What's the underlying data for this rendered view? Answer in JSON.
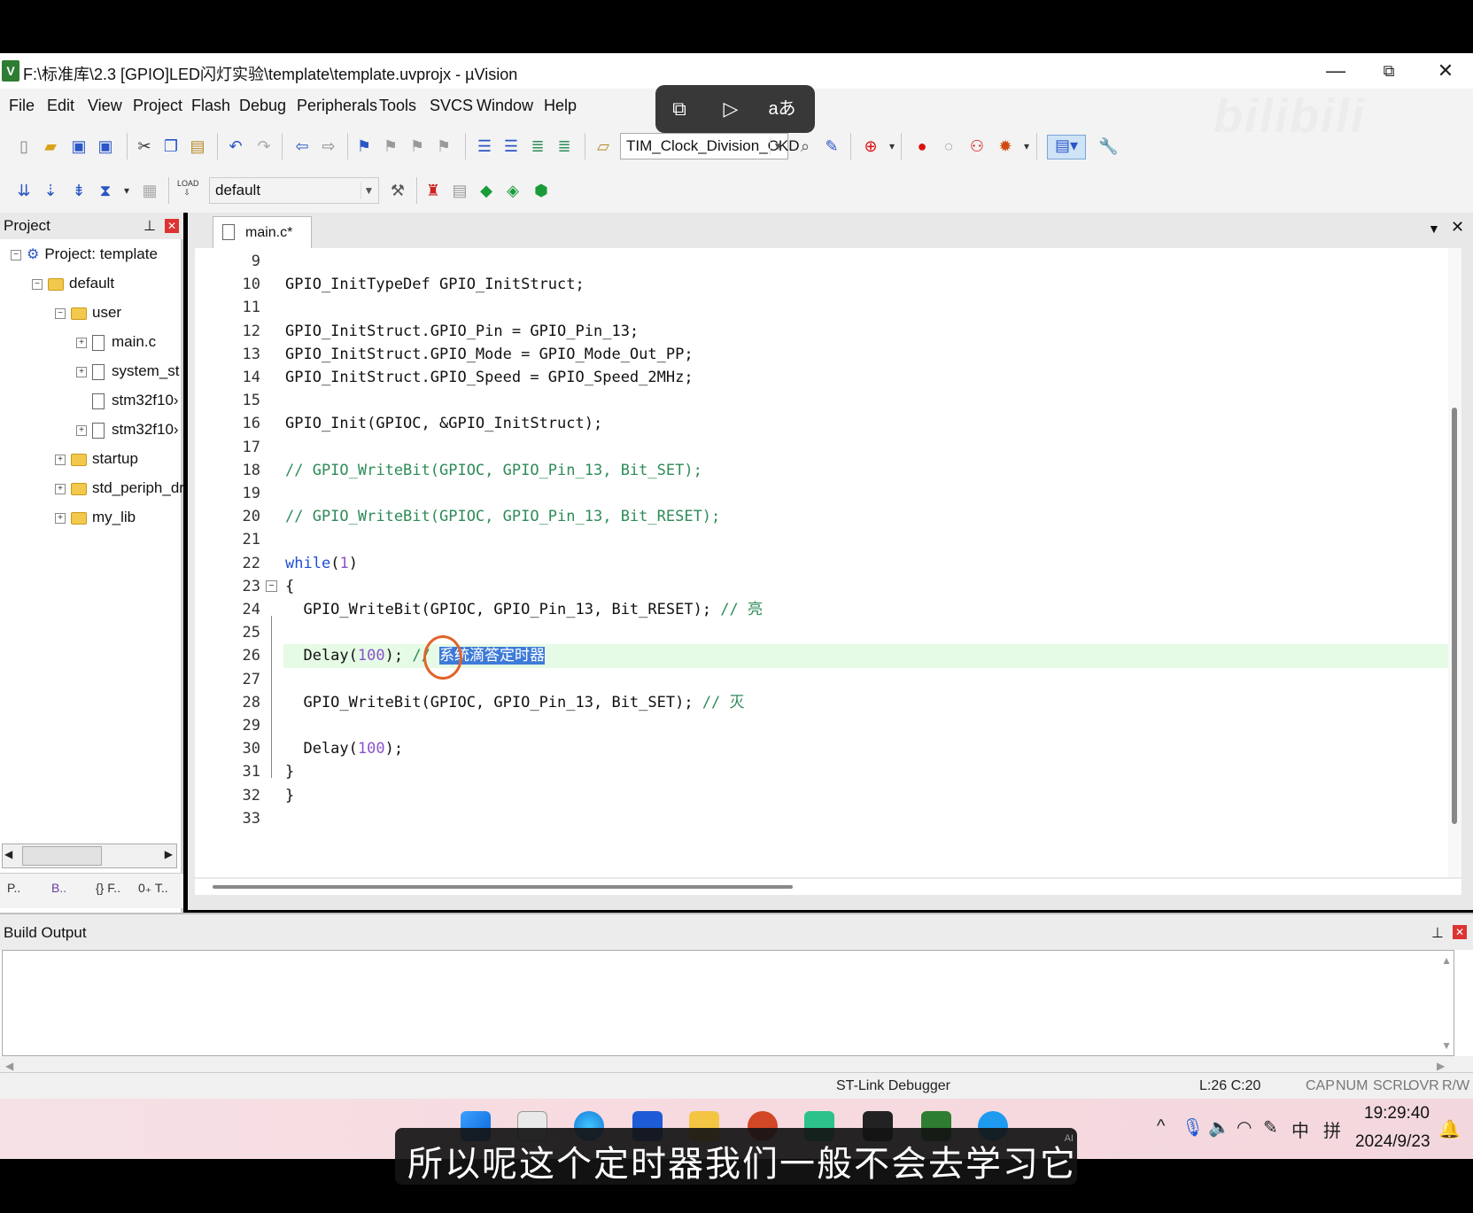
{
  "window": {
    "title": "F:\\标准库\\2.3 [GPIO]LED闪灯实验\\template\\template.uvprojx - µVision",
    "app_icon": "V",
    "minimize": "—",
    "maximize": "⧉",
    "close": "✕"
  },
  "menu": [
    "File",
    "Edit",
    "View",
    "Project",
    "Flash",
    "Debug",
    "Peripherals",
    "Tools",
    "SVCS",
    "Window",
    "Help"
  ],
  "toolbar1": {
    "find_combo": "TIM_Clock_Division_CKD"
  },
  "toolbar2": {
    "target_combo": "default"
  },
  "overlay": {
    "icons": [
      "screen-exit-icon",
      "ai-play-icon",
      "translate-icon"
    ],
    "translate_label": "aあ"
  },
  "watermark": "bilibili",
  "project_panel": {
    "title": "Project",
    "tree": [
      {
        "label": "Project: template",
        "level": 0,
        "kind": "project",
        "expander": "−"
      },
      {
        "label": "default",
        "level": 1,
        "kind": "target",
        "expander": "−"
      },
      {
        "label": "user",
        "level": 2,
        "kind": "folder",
        "expander": "−"
      },
      {
        "label": "main.c",
        "level": 3,
        "kind": "file",
        "expander": "+"
      },
      {
        "label": "system_st",
        "level": 3,
        "kind": "file",
        "expander": "+"
      },
      {
        "label": "stm32f10›",
        "level": 3,
        "kind": "file",
        "expander": ""
      },
      {
        "label": "stm32f10›",
        "level": 3,
        "kind": "file",
        "expander": "+"
      },
      {
        "label": "startup",
        "level": 2,
        "kind": "folder",
        "expander": "+"
      },
      {
        "label": "std_periph_dr",
        "level": 2,
        "kind": "folder",
        "expander": "+"
      },
      {
        "label": "my_lib",
        "level": 2,
        "kind": "folder",
        "expander": "+"
      }
    ],
    "tabs": [
      "P..",
      "B..",
      "{} F..",
      "0₊ T.."
    ]
  },
  "editor": {
    "tab": "main.c*",
    "lines": [
      {
        "n": "9",
        "code": ""
      },
      {
        "n": "10",
        "code": "GPIO_InitTypeDef GPIO_InitStruct;"
      },
      {
        "n": "11",
        "code": ""
      },
      {
        "n": "12",
        "code": "GPIO_InitStruct.GPIO_Pin = GPIO_Pin_13;"
      },
      {
        "n": "13",
        "code": "GPIO_InitStruct.GPIO_Mode = GPIO_Mode_Out_PP;"
      },
      {
        "n": "14",
        "code": "GPIO_InitStruct.GPIO_Speed = GPIO_Speed_2MHz;"
      },
      {
        "n": "15",
        "code": ""
      },
      {
        "n": "16",
        "code": "GPIO_Init(GPIOC, &GPIO_InitStruct);"
      },
      {
        "n": "17",
        "code": ""
      },
      {
        "n": "18",
        "code": "// GPIO_WriteBit(GPIOC, GPIO_Pin_13, Bit_SET);"
      },
      {
        "n": "19",
        "code": ""
      },
      {
        "n": "20",
        "code": "// GPIO_WriteBit(GPIOC, GPIO_Pin_13, Bit_RESET);"
      },
      {
        "n": "21",
        "code": ""
      },
      {
        "n": "22",
        "code": "while(1)"
      },
      {
        "n": "23",
        "code": "{"
      },
      {
        "n": "24",
        "code": "  GPIO_WriteBit(GPIOC, GPIO_Pin_13, Bit_RESET); // 亮"
      },
      {
        "n": "25",
        "code": ""
      },
      {
        "n": "26",
        "code": "  Delay(100); // 系统滴答定时器"
      },
      {
        "n": "27",
        "code": ""
      },
      {
        "n": "28",
        "code": "  GPIO_WriteBit(GPIOC, GPIO_Pin_13, Bit_SET); // 灭"
      },
      {
        "n": "29",
        "code": ""
      },
      {
        "n": "30",
        "code": "  Delay(100);"
      },
      {
        "n": "31",
        "code": "}"
      },
      {
        "n": "32",
        "code": "}"
      },
      {
        "n": "33",
        "code": ""
      }
    ],
    "highlighted_line": "26",
    "selected_text": "系统滴答定时器"
  },
  "build_output": {
    "title": "Build Output"
  },
  "status": {
    "debugger": "ST-Link Debugger",
    "cursor": "L:26 C:20",
    "indicators": [
      "CAP",
      "NUM",
      "SCRL",
      "OVR",
      "R/W"
    ]
  },
  "taskbar": {
    "apps": [
      "windows-start-icon",
      "notepad-icon",
      "edge-icon",
      "vscode-icon",
      "file-explorer-icon",
      "powerpoint-icon",
      "green-app-icon",
      "camera-app-icon",
      "keil-icon",
      "bilibili-icon"
    ],
    "tray": [
      "^",
      "mic-icon",
      "speaker-icon",
      "wifi-icon",
      "pen-icon",
      "中",
      "拼"
    ],
    "time": "19:29:40",
    "date": "2024/9/23"
  },
  "subtitle": {
    "text": "所以呢这个定时器我们一般不会去学习它",
    "ai_badge": "AI"
  },
  "colors": {
    "comment": "#2e8b57",
    "keyword": "#1f4fd6",
    "number": "#8a54c8",
    "highlight_line": "#e6fbe6",
    "selection": "#3d7bd9",
    "circle": "#e0642a"
  }
}
